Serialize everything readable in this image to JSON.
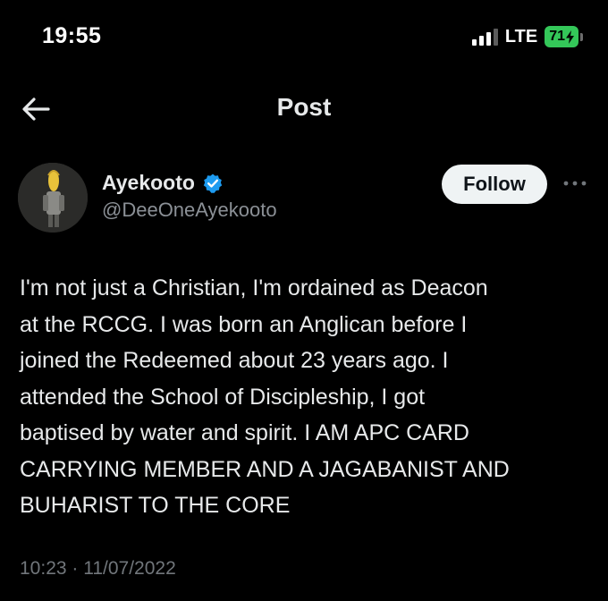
{
  "status_bar": {
    "time": "19:55",
    "network": "LTE",
    "battery": "71",
    "signal_bars_active": 3,
    "signal_bars_total": 4
  },
  "header": {
    "title": "Post",
    "back_icon": "arrow-left-icon"
  },
  "author": {
    "display_name": "Ayekooto",
    "handle": "@DeeOneAyekooto",
    "verified_icon": "verified-badge-icon",
    "follow_label": "Follow",
    "more_icon": "more-horizontal-icon"
  },
  "post": {
    "lines": [
      "I'm not just a Christian, I'm ordained as Deacon",
      "at the RCCG. I was born an Anglican before I",
      "joined the Redeemed about 23 years ago. I",
      "attended the School of Discipleship, I got",
      "baptised by water and spirit. I AM APC CARD",
      "CARRYING MEMBER AND A JAGABANIST AND",
      "BUHARIST TO THE CORE"
    ],
    "timestamp": "10:23 · 11/07/2022"
  },
  "colors": {
    "background": "#000000",
    "text_primary": "#e7e9ea",
    "text_secondary": "#71767b",
    "verified_blue": "#1d9bf0",
    "battery_green": "#34c759"
  }
}
